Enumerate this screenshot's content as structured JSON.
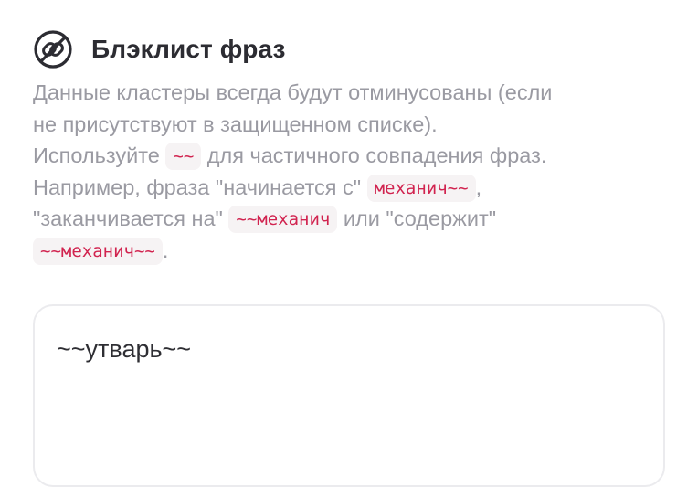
{
  "header": {
    "icon": "no-link-icon",
    "title": "Блэклист фраз"
  },
  "description": {
    "line1": "Данные кластеры всегда будут отминусованы (если",
    "line2": "не присутствуют в защищенном списке).",
    "line3_before": "Используйте",
    "line3_code": "~~",
    "line3_after": "для частичного совпадения фраз.",
    "line4_before": "Например, фраза \"начинается с\"",
    "line4_code": "механич~~",
    "line4_after": ",",
    "line5_before": "\"заканчивается на\"",
    "line5_code": "~~механич",
    "line5_after": "или \"содержит\"",
    "line6_code": "~~механич~~",
    "line6_after": "."
  },
  "blacklist_input": {
    "value": "~~утварь~~"
  },
  "colors": {
    "title": "#2c2c32",
    "text_muted": "#9a9aa2",
    "code_text": "#d1234f",
    "code_bg": "#f6f3f4",
    "border": "#ebebee"
  }
}
